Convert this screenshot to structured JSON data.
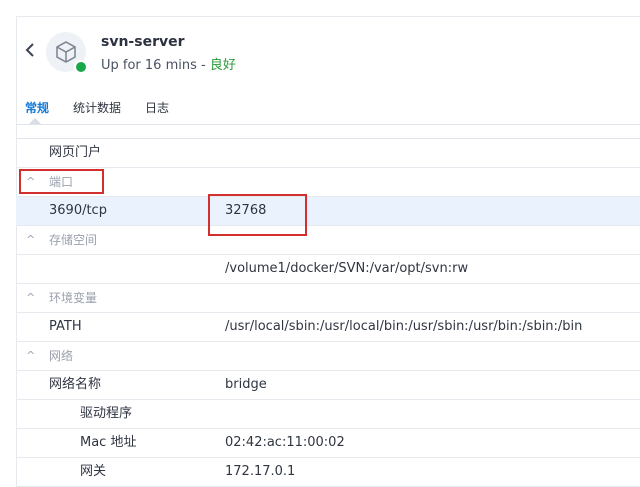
{
  "header": {
    "back_icon": "chevron-left-icon",
    "avatar_icon": "cube-icon",
    "status_color": "#1aa64a",
    "name": "svn-server",
    "uptime": "Up for 16 mins",
    "separator": " - ",
    "health": "良好"
  },
  "tabs": [
    {
      "label": "常规",
      "active": true
    },
    {
      "label": "统计数据",
      "active": false
    },
    {
      "label": "日志",
      "active": false
    }
  ],
  "rows": {
    "web_portal": {
      "key": "网页门户"
    },
    "ports_section": {
      "label": "端口"
    },
    "port": {
      "key": "3690/tcp",
      "value": "32768"
    },
    "storage_section": {
      "label": "存储空间"
    },
    "storage": {
      "value": "/volume1/docker/SVN:/var/opt/svn:rw"
    },
    "env_section": {
      "label": "环境变量"
    },
    "path": {
      "key": "PATH",
      "value": "/usr/local/sbin:/usr/local/bin:/usr/sbin:/usr/bin:/sbin:/bin"
    },
    "network_section": {
      "label": "网络"
    },
    "network_name": {
      "key": "网络名称",
      "value": "bridge"
    },
    "driver": {
      "key": "驱动程序"
    },
    "mac": {
      "key": "Mac 地址",
      "value": "02:42:ac:11:00:02"
    },
    "gateway": {
      "key": "网关",
      "value": "172.17.0.1"
    }
  },
  "highlight_color": "#d32f2f"
}
